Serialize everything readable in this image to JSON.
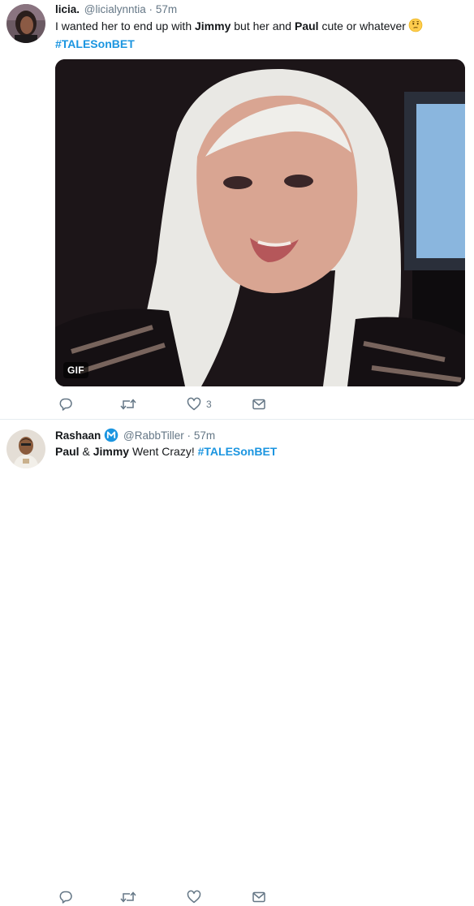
{
  "tweets": [
    {
      "display_name": "licia.",
      "handle": "@licialynntia",
      "separator": "·",
      "time": "57m",
      "text_parts": [
        "I wanted her to end up with ",
        "Jimmy",
        " but her and ",
        "Paul",
        " cute or whatever"
      ],
      "emoji": "thinking-face",
      "hashtag": "#TALESonBET",
      "media": {
        "badge": "GIF"
      },
      "actions": {
        "reply_count": "",
        "retweet_count": "",
        "like_count": "3"
      }
    },
    {
      "display_name": "Rashaan",
      "handle": "@RabbTiller",
      "separator": "·",
      "time": "57m",
      "text_parts": [
        "Paul",
        " & ",
        "Jimmy",
        " Went Crazy! "
      ],
      "hashtag": "#TALESonBET",
      "actions": {
        "reply_count": "",
        "retweet_count": "",
        "like_count": ""
      }
    }
  ],
  "colors": {
    "text": "#14171a",
    "secondary": "#657786",
    "link": "#1b95e0",
    "divider": "#e6ecf0",
    "verified_badge": "#1b95e0"
  }
}
